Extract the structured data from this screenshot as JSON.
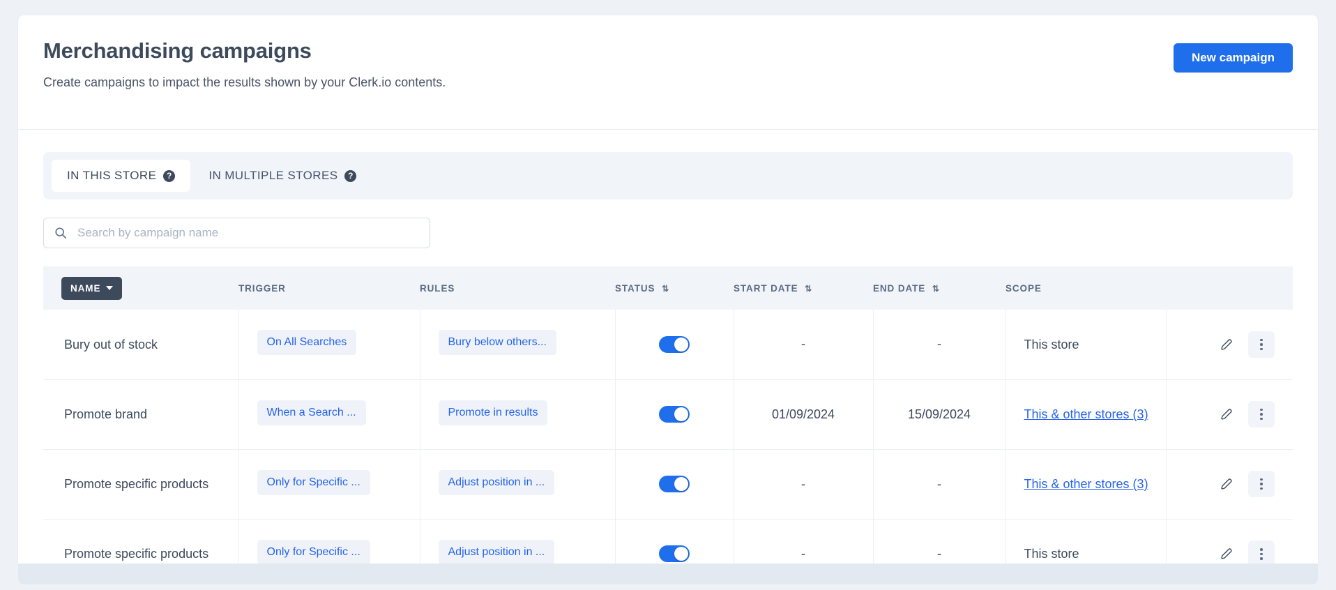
{
  "header": {
    "title": "Merchandising campaigns",
    "subtitle": "Create campaigns to impact the results shown by your Clerk.io contents.",
    "new_campaign_label": "New campaign"
  },
  "tabs": [
    {
      "label": "IN THIS STORE",
      "active": true,
      "help": "?"
    },
    {
      "label": "IN MULTIPLE STORES",
      "active": false,
      "help": "?"
    }
  ],
  "search": {
    "placeholder": "Search by campaign name",
    "value": ""
  },
  "table": {
    "columns": {
      "name": "NAME",
      "trigger": "TRIGGER",
      "rules": "RULES",
      "status": "STATUS",
      "start_date": "START DATE",
      "end_date": "END DATE",
      "scope": "SCOPE"
    },
    "sort_indicator": "⇅",
    "rows": [
      {
        "name": "Bury out of stock",
        "trigger": "On All Searches",
        "rules": "Bury below others...",
        "status_on": true,
        "start_date": "-",
        "end_date": "-",
        "scope": "This store",
        "scope_is_link": false
      },
      {
        "name": "Promote brand",
        "trigger": "When a Search ...",
        "rules": "Promote in results",
        "status_on": true,
        "start_date": "01/09/2024",
        "end_date": "15/09/2024",
        "scope": "This & other stores (3)",
        "scope_is_link": true
      },
      {
        "name": "Promote specific products",
        "trigger": "Only for Specific ...",
        "rules": "Adjust position in ...",
        "status_on": true,
        "start_date": "-",
        "end_date": "-",
        "scope": "This & other stores (3)",
        "scope_is_link": true
      },
      {
        "name": "Promote specific products",
        "trigger": "Only for Specific ...",
        "rules": "Adjust position in ...",
        "status_on": true,
        "start_date": "-",
        "end_date": "-",
        "scope": "This store",
        "scope_is_link": false
      }
    ]
  },
  "colors": {
    "accent": "#1f6fed",
    "link": "#2563eb",
    "heading": "#3d4a5c",
    "page_bg": "#eef2f7",
    "panel_bg": "#f1f4f9"
  }
}
